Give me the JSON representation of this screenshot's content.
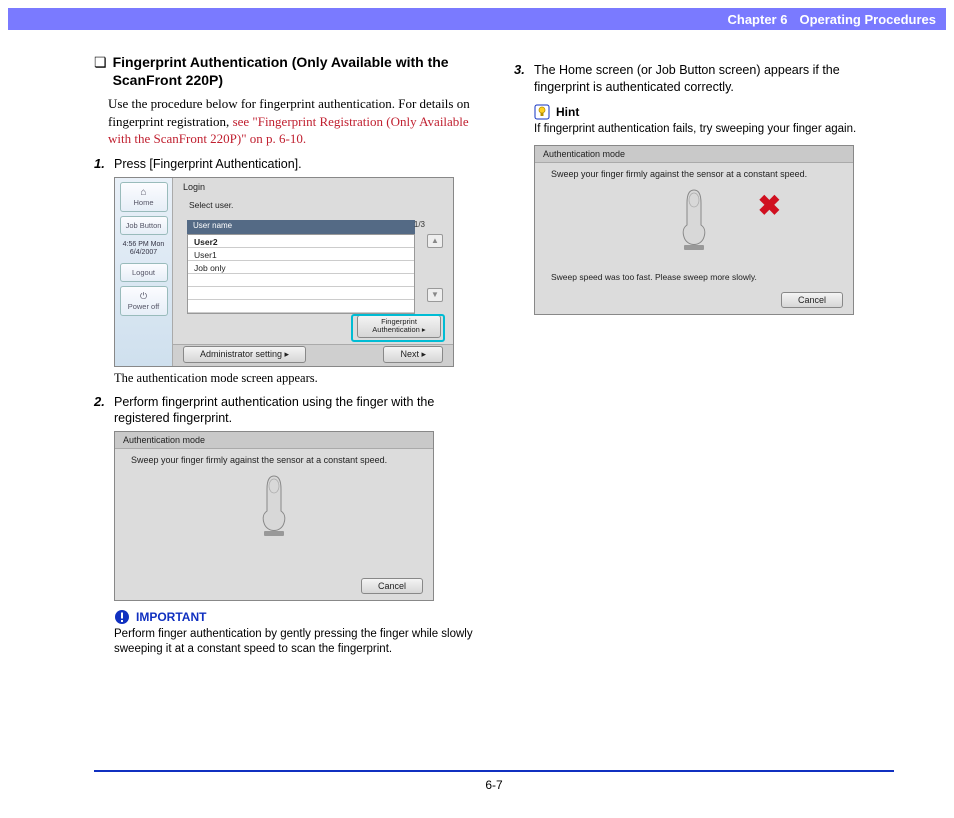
{
  "header": {
    "chapter": "Chapter 6",
    "title": "Operating Procedures"
  },
  "left": {
    "section_bullet": "❏",
    "section_title": "Fingerprint Authentication (Only Available with the ScanFront 220P)",
    "intro_plain": "Use the procedure below for fingerprint authentication. For details on fingerprint registration, ",
    "intro_link": "see \"Fingerprint Registration (Only Available with the ScanFront 220P)\" on p. 6-10.",
    "step1_num": "1.",
    "step1_text": "Press [Fingerprint Authentication].",
    "shot1": {
      "side_home": "Home",
      "side_job": "Job Button",
      "side_time": "4:56 PM  Mon 6/4/2007",
      "side_logout": "Logout",
      "side_power": "Power off",
      "login": "Login",
      "select_user": "Select user.",
      "col_user": "User name",
      "page": "1/3",
      "u1": "User2",
      "u2": "User1",
      "u3": "Job only",
      "fp_btn": "Fingerprint Authentication  ▸",
      "admin": "Administrator setting   ▸",
      "next": "Next          ▸"
    },
    "caption1": "The authentication mode screen appears.",
    "step2_num": "2.",
    "step2_text": "Perform fingerprint authentication using the finger with the registered fingerprint.",
    "shot2": {
      "title": "Authentication mode",
      "inst": "Sweep your finger firmly against the sensor at a constant speed.",
      "cancel": "Cancel"
    },
    "important_label": "IMPORTANT",
    "important_text": "Perform finger authentication by gently pressing the finger while slowly sweeping it at a constant speed to scan the fingerprint."
  },
  "right": {
    "step3_num": "3.",
    "step3_text": "The Home screen (or Job Button screen) appears if the fingerprint is authenticated correctly.",
    "hint_label": "Hint",
    "hint_text": "If fingerprint authentication fails, try sweeping your finger again.",
    "shot3": {
      "title": "Authentication mode",
      "inst": "Sweep your finger firmly against the sensor at a constant speed.",
      "err": "Sweep speed was too fast. Please sweep more slowly.",
      "cancel": "Cancel"
    }
  },
  "footer": {
    "page": "6-7"
  }
}
